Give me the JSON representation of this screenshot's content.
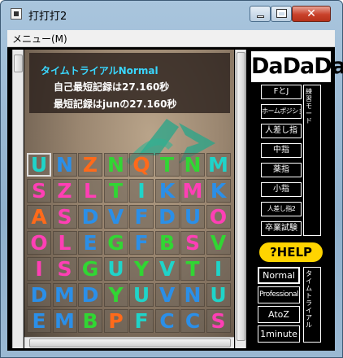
{
  "window": {
    "title": "打打打2"
  },
  "menu": {
    "label": "メニュー(M)"
  },
  "info": {
    "title": "タイムトライアルNormal",
    "line1": "自己最短記録は27.160秒",
    "line2": "最短記録はjunの27.160秒"
  },
  "grid": {
    "rows": [
      [
        {
          "ch": "U",
          "color": "#1fd4c9"
        },
        {
          "ch": "N",
          "color": "#2b8fe8"
        },
        {
          "ch": "Z",
          "color": "#ff6a1a"
        },
        {
          "ch": "N",
          "color": "#31d633"
        },
        {
          "ch": "Q",
          "color": "#ff6a1a"
        },
        {
          "ch": "T",
          "color": "#31d633"
        },
        {
          "ch": "N",
          "color": "#31d633"
        },
        {
          "ch": "M",
          "color": "#1fd4c9"
        }
      ],
      [
        {
          "ch": "S",
          "color": "#ff3fb5"
        },
        {
          "ch": "Z",
          "color": "#ff3fb5"
        },
        {
          "ch": "L",
          "color": "#ff3fb5"
        },
        {
          "ch": "T",
          "color": "#31d633"
        },
        {
          "ch": "I",
          "color": "#1fd4c9"
        },
        {
          "ch": "K",
          "color": "#2b8fe8"
        },
        {
          "ch": "M",
          "color": "#ff3fb5"
        },
        {
          "ch": "K",
          "color": "#2b8fe8"
        }
      ],
      [
        {
          "ch": "A",
          "color": "#ff6a1a"
        },
        {
          "ch": "S",
          "color": "#ff3fb5"
        },
        {
          "ch": "D",
          "color": "#2b8fe8"
        },
        {
          "ch": "V",
          "color": "#2b8fe8"
        },
        {
          "ch": "F",
          "color": "#2b8fe8"
        },
        {
          "ch": "D",
          "color": "#2b8fe8"
        },
        {
          "ch": "U",
          "color": "#2b8fe8"
        },
        {
          "ch": "O",
          "color": "#ff3fb5"
        }
      ],
      [
        {
          "ch": "O",
          "color": "#ff3fb5"
        },
        {
          "ch": "L",
          "color": "#ff3fb5"
        },
        {
          "ch": "E",
          "color": "#2b8fe8"
        },
        {
          "ch": "G",
          "color": "#31d633"
        },
        {
          "ch": "F",
          "color": "#2b8fe8"
        },
        {
          "ch": "B",
          "color": "#31d633"
        },
        {
          "ch": "S",
          "color": "#ff3fb5"
        },
        {
          "ch": "V",
          "color": "#31d633"
        }
      ],
      [
        {
          "ch": "I",
          "color": "#ff3fb5"
        },
        {
          "ch": "S",
          "color": "#ff3fb5"
        },
        {
          "ch": "G",
          "color": "#31d633"
        },
        {
          "ch": "U",
          "color": "#1fd4c9"
        },
        {
          "ch": "Y",
          "color": "#31d633"
        },
        {
          "ch": "V",
          "color": "#1fd4c9"
        },
        {
          "ch": "T",
          "color": "#31d633"
        },
        {
          "ch": "I",
          "color": "#1fd4c9"
        }
      ],
      [
        {
          "ch": "D",
          "color": "#2b8fe8"
        },
        {
          "ch": "M",
          "color": "#2b8fe8"
        },
        {
          "ch": "D",
          "color": "#2b8fe8"
        },
        {
          "ch": "Y",
          "color": "#31d633"
        },
        {
          "ch": "U",
          "color": "#1fd4c9"
        },
        {
          "ch": "V",
          "color": "#2b8fe8"
        },
        {
          "ch": "N",
          "color": "#2b8fe8"
        },
        {
          "ch": "U",
          "color": "#1fd4c9"
        }
      ],
      [
        {
          "ch": "E",
          "color": "#2b8fe8"
        },
        {
          "ch": "M",
          "color": "#2b8fe8"
        },
        {
          "ch": "B",
          "color": "#31d633"
        },
        {
          "ch": "P",
          "color": "#ff6a1a"
        },
        {
          "ch": "F",
          "color": "#1fd4c9"
        },
        {
          "ch": "C",
          "color": "#2b8fe8"
        },
        {
          "ch": "C",
          "color": "#2b8fe8"
        },
        {
          "ch": "S",
          "color": "#ff3fb5"
        }
      ]
    ]
  },
  "side": {
    "logo": "DaDaDa",
    "modes": [
      "FとJ",
      "ホームポジション",
      "人差し指",
      "中指",
      "薬指",
      "小指",
      "人差し指2",
      "卒業試験"
    ],
    "practice_label": "練習モード",
    "help_label": "?HELP",
    "trials": [
      "Normal",
      "Professional",
      "AtoZ",
      "1minute"
    ],
    "trial_label": "タイムトライアル",
    "selected_trial": "Normal"
  }
}
